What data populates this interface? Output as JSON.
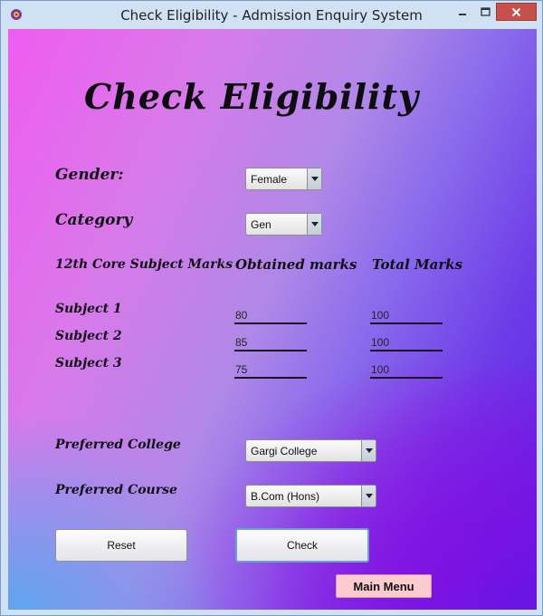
{
  "window": {
    "title": "Check Eligibility - Admission Enquiry System"
  },
  "page": {
    "heading": "Check Eligibility",
    "gender_label": "Gender:",
    "gender_value": "Female",
    "category_label": "Category",
    "category_value": "Gen",
    "marks_header": "12th Core Subject Marks",
    "obtained_header": "Obtained marks",
    "total_header": "Total Marks",
    "subjects": [
      {
        "label": "Subject 1",
        "obtained": "80",
        "total": "100"
      },
      {
        "label": "Subject 2",
        "obtained": "85",
        "total": "100"
      },
      {
        "label": "Subject 3",
        "obtained": "75",
        "total": "100"
      }
    ],
    "college_label": "Preferred College",
    "college_value": "Gargi College",
    "course_label": "Preferred Course",
    "course_value": "B.Com (Hons)",
    "reset_label": "Reset",
    "check_label": "Check",
    "main_menu_label": "Main Menu"
  },
  "colors": {
    "gradient_start": "#ef5cf0",
    "gradient_end": "#5a1de0",
    "main_menu_bg": "#fccbd0"
  }
}
